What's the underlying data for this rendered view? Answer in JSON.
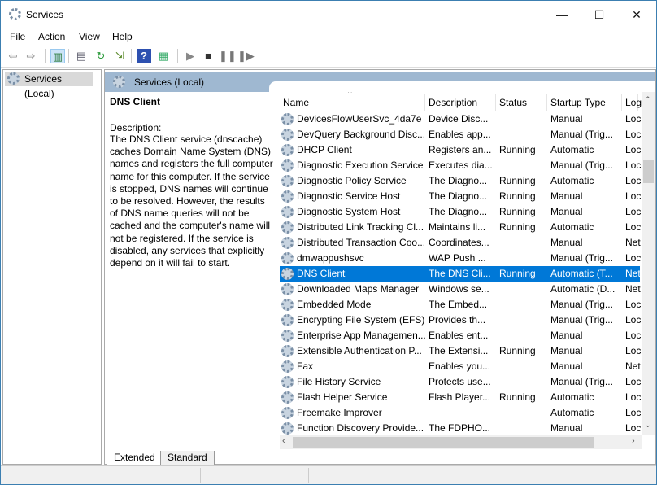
{
  "window": {
    "title": "Services",
    "minimize": "—",
    "maximize": "☐",
    "close": "✕"
  },
  "menu": [
    "File",
    "Action",
    "View",
    "Help"
  ],
  "toolbar": [
    {
      "icon": "back-icon",
      "glyph": "⇦"
    },
    {
      "icon": "forward-icon",
      "glyph": "⇨"
    },
    {
      "icon": "show-hide-console-tree-icon",
      "glyph": "▥"
    },
    {
      "icon": "properties-icon",
      "glyph": "▤"
    },
    {
      "icon": "refresh-icon",
      "glyph": "↻"
    },
    {
      "icon": "export-list-icon",
      "glyph": "⇲"
    },
    {
      "icon": "help-icon",
      "glyph": "?"
    },
    {
      "icon": "show-action-pane-icon",
      "glyph": "▦"
    },
    {
      "icon": "start-service-icon",
      "glyph": "▶"
    },
    {
      "icon": "stop-service-icon",
      "glyph": "■"
    },
    {
      "icon": "pause-service-icon",
      "glyph": "❚❚"
    },
    {
      "icon": "restart-service-icon",
      "glyph": "❚▶"
    }
  ],
  "tree": {
    "item": "Services (Local)"
  },
  "band": {
    "title": "Services (Local)"
  },
  "details": {
    "title": "DNS Client",
    "label": "Description:",
    "text": "The DNS Client service (dnscache) caches Domain Name System (DNS) names and registers the full computer name for this computer. If the service is stopped, DNS names will continue to be resolved. However, the results of DNS name queries will not be cached and the computer's name will not be registered. If the service is disabled, any services that explicitly depend on it will fail to start."
  },
  "columns": [
    "Name",
    "Description",
    "Status",
    "Startup Type",
    "Log"
  ],
  "rows": [
    [
      "DevicesFlowUserSvc_4da7e",
      "Device Disc...",
      "",
      "Manual",
      "Loc"
    ],
    [
      "DevQuery Background Disc...",
      "Enables app...",
      "",
      "Manual (Trig...",
      "Loc"
    ],
    [
      "DHCP Client",
      "Registers an...",
      "Running",
      "Automatic",
      "Loc"
    ],
    [
      "Diagnostic Execution Service",
      "Executes dia...",
      "",
      "Manual (Trig...",
      "Loc"
    ],
    [
      "Diagnostic Policy Service",
      "The Diagno...",
      "Running",
      "Automatic",
      "Loc"
    ],
    [
      "Diagnostic Service Host",
      "The Diagno...",
      "Running",
      "Manual",
      "Loc"
    ],
    [
      "Diagnostic System Host",
      "The Diagno...",
      "Running",
      "Manual",
      "Loc"
    ],
    [
      "Distributed Link Tracking Cl...",
      "Maintains li...",
      "Running",
      "Automatic",
      "Loc"
    ],
    [
      "Distributed Transaction Coo...",
      "Coordinates...",
      "",
      "Manual",
      "Net"
    ],
    [
      "dmwappushsvc",
      "WAP Push ...",
      "",
      "Manual (Trig...",
      "Loc"
    ],
    [
      "DNS Client",
      "The DNS Cli...",
      "Running",
      "Automatic (T...",
      "Net"
    ],
    [
      "Downloaded Maps Manager",
      "Windows se...",
      "",
      "Automatic (D...",
      "Net"
    ],
    [
      "Embedded Mode",
      "The Embed...",
      "",
      "Manual (Trig...",
      "Loc"
    ],
    [
      "Encrypting File System (EFS)",
      "Provides th...",
      "",
      "Manual (Trig...",
      "Loc"
    ],
    [
      "Enterprise App Managemen...",
      "Enables ent...",
      "",
      "Manual",
      "Loc"
    ],
    [
      "Extensible Authentication P...",
      "The Extensi...",
      "Running",
      "Manual",
      "Loc"
    ],
    [
      "Fax",
      "Enables you...",
      "",
      "Manual",
      "Net"
    ],
    [
      "File History Service",
      "Protects use...",
      "",
      "Manual (Trig...",
      "Loc"
    ],
    [
      "Flash Helper Service",
      "Flash Player...",
      "Running",
      "Automatic",
      "Loc"
    ],
    [
      "Freemake Improver",
      "",
      "",
      "Automatic",
      "Loc"
    ],
    [
      "Function Discovery Provide...",
      "The FDPHO...",
      "",
      "Manual",
      "Loc"
    ]
  ],
  "selected_row": 10,
  "tabs": [
    "Extended",
    "Standard"
  ],
  "active_tab": 0
}
